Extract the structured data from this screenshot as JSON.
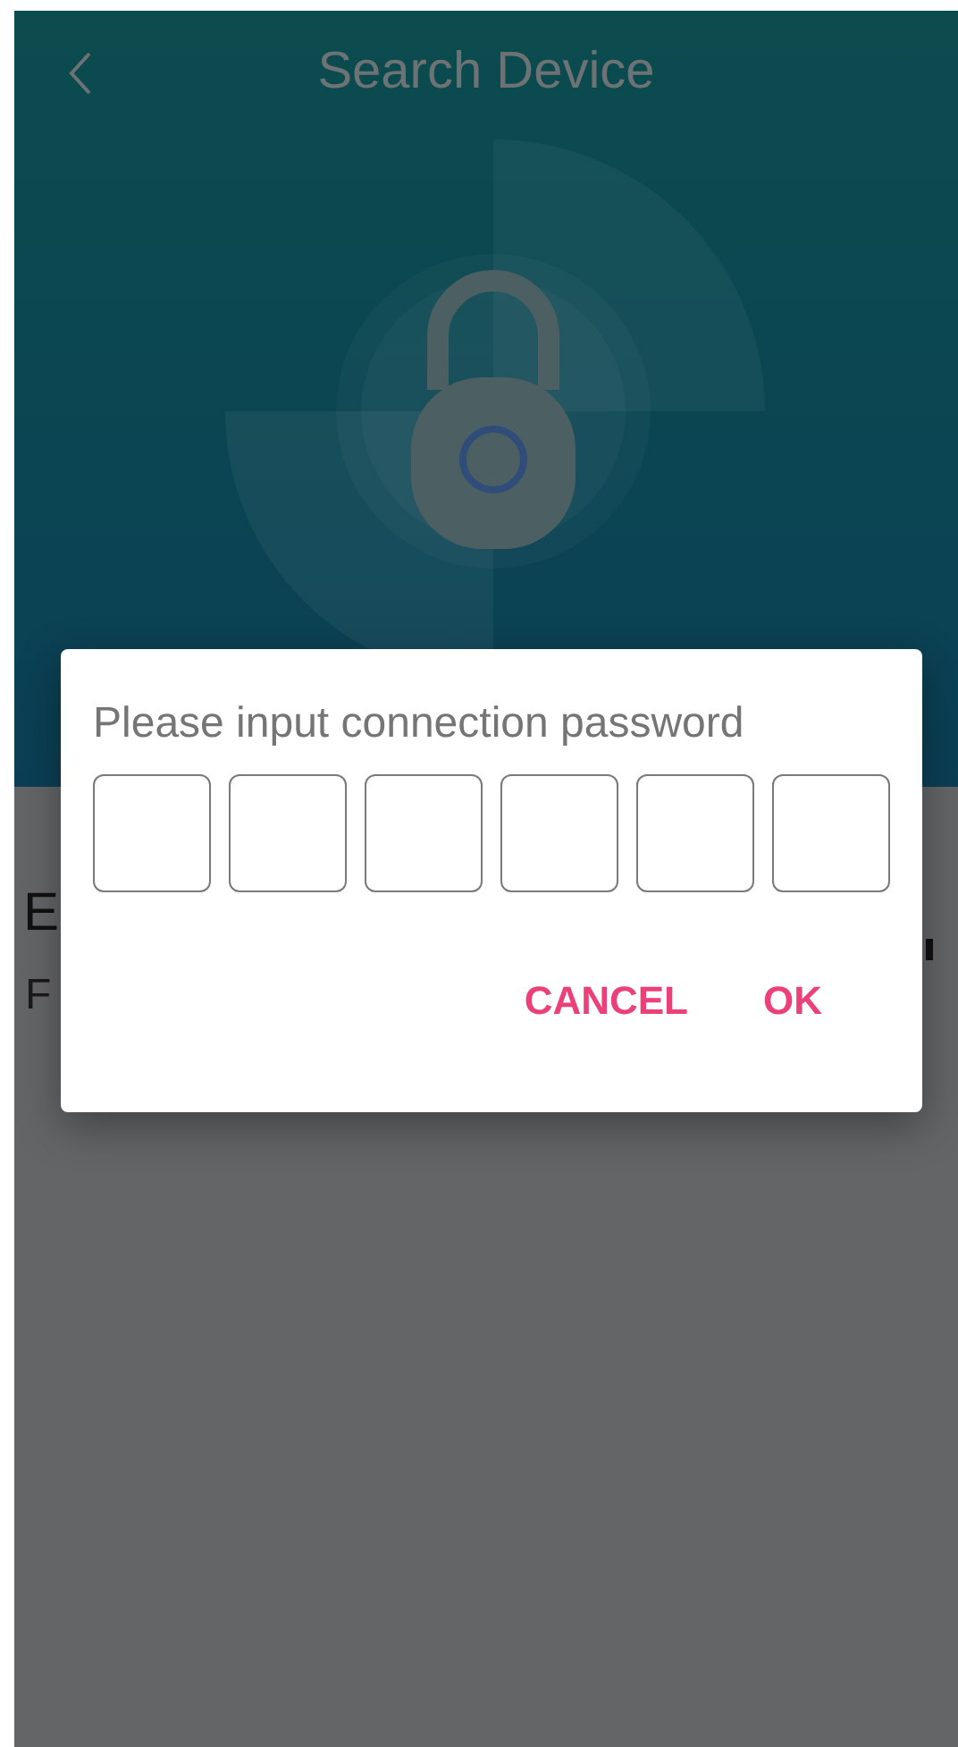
{
  "header": {
    "title": "Search Device"
  },
  "background_text": [
    {
      "text": "E"
    },
    {
      "text": "F"
    }
  ],
  "dialog": {
    "title": "Please input connection password",
    "code_boxes": [
      {
        "filled": false
      },
      {
        "filled": false
      },
      {
        "filled": false
      },
      {
        "filled": false
      },
      {
        "filled": false
      },
      {
        "filled": false
      }
    ],
    "buttons": [
      "CANCEL",
      "OK"
    ]
  }
}
